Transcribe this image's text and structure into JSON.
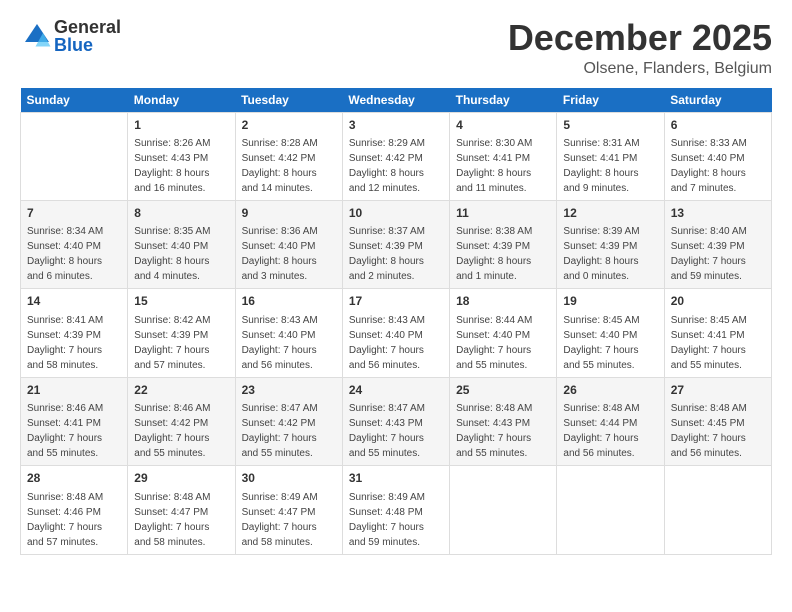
{
  "logo": {
    "general": "General",
    "blue": "Blue"
  },
  "title": "December 2025",
  "subtitle": "Olsene, Flanders, Belgium",
  "days_of_week": [
    "Sunday",
    "Monday",
    "Tuesday",
    "Wednesday",
    "Thursday",
    "Friday",
    "Saturday"
  ],
  "weeks": [
    [
      {
        "day": "",
        "content": ""
      },
      {
        "day": "1",
        "content": "Sunrise: 8:26 AM\nSunset: 4:43 PM\nDaylight: 8 hours\nand 16 minutes."
      },
      {
        "day": "2",
        "content": "Sunrise: 8:28 AM\nSunset: 4:42 PM\nDaylight: 8 hours\nand 14 minutes."
      },
      {
        "day": "3",
        "content": "Sunrise: 8:29 AM\nSunset: 4:42 PM\nDaylight: 8 hours\nand 12 minutes."
      },
      {
        "day": "4",
        "content": "Sunrise: 8:30 AM\nSunset: 4:41 PM\nDaylight: 8 hours\nand 11 minutes."
      },
      {
        "day": "5",
        "content": "Sunrise: 8:31 AM\nSunset: 4:41 PM\nDaylight: 8 hours\nand 9 minutes."
      },
      {
        "day": "6",
        "content": "Sunrise: 8:33 AM\nSunset: 4:40 PM\nDaylight: 8 hours\nand 7 minutes."
      }
    ],
    [
      {
        "day": "7",
        "content": "Sunrise: 8:34 AM\nSunset: 4:40 PM\nDaylight: 8 hours\nand 6 minutes."
      },
      {
        "day": "8",
        "content": "Sunrise: 8:35 AM\nSunset: 4:40 PM\nDaylight: 8 hours\nand 4 minutes."
      },
      {
        "day": "9",
        "content": "Sunrise: 8:36 AM\nSunset: 4:40 PM\nDaylight: 8 hours\nand 3 minutes."
      },
      {
        "day": "10",
        "content": "Sunrise: 8:37 AM\nSunset: 4:39 PM\nDaylight: 8 hours\nand 2 minutes."
      },
      {
        "day": "11",
        "content": "Sunrise: 8:38 AM\nSunset: 4:39 PM\nDaylight: 8 hours\nand 1 minute."
      },
      {
        "day": "12",
        "content": "Sunrise: 8:39 AM\nSunset: 4:39 PM\nDaylight: 8 hours\nand 0 minutes."
      },
      {
        "day": "13",
        "content": "Sunrise: 8:40 AM\nSunset: 4:39 PM\nDaylight: 7 hours\nand 59 minutes."
      }
    ],
    [
      {
        "day": "14",
        "content": "Sunrise: 8:41 AM\nSunset: 4:39 PM\nDaylight: 7 hours\nand 58 minutes."
      },
      {
        "day": "15",
        "content": "Sunrise: 8:42 AM\nSunset: 4:39 PM\nDaylight: 7 hours\nand 57 minutes."
      },
      {
        "day": "16",
        "content": "Sunrise: 8:43 AM\nSunset: 4:40 PM\nDaylight: 7 hours\nand 56 minutes."
      },
      {
        "day": "17",
        "content": "Sunrise: 8:43 AM\nSunset: 4:40 PM\nDaylight: 7 hours\nand 56 minutes."
      },
      {
        "day": "18",
        "content": "Sunrise: 8:44 AM\nSunset: 4:40 PM\nDaylight: 7 hours\nand 55 minutes."
      },
      {
        "day": "19",
        "content": "Sunrise: 8:45 AM\nSunset: 4:40 PM\nDaylight: 7 hours\nand 55 minutes."
      },
      {
        "day": "20",
        "content": "Sunrise: 8:45 AM\nSunset: 4:41 PM\nDaylight: 7 hours\nand 55 minutes."
      }
    ],
    [
      {
        "day": "21",
        "content": "Sunrise: 8:46 AM\nSunset: 4:41 PM\nDaylight: 7 hours\nand 55 minutes."
      },
      {
        "day": "22",
        "content": "Sunrise: 8:46 AM\nSunset: 4:42 PM\nDaylight: 7 hours\nand 55 minutes."
      },
      {
        "day": "23",
        "content": "Sunrise: 8:47 AM\nSunset: 4:42 PM\nDaylight: 7 hours\nand 55 minutes."
      },
      {
        "day": "24",
        "content": "Sunrise: 8:47 AM\nSunset: 4:43 PM\nDaylight: 7 hours\nand 55 minutes."
      },
      {
        "day": "25",
        "content": "Sunrise: 8:48 AM\nSunset: 4:43 PM\nDaylight: 7 hours\nand 55 minutes."
      },
      {
        "day": "26",
        "content": "Sunrise: 8:48 AM\nSunset: 4:44 PM\nDaylight: 7 hours\nand 56 minutes."
      },
      {
        "day": "27",
        "content": "Sunrise: 8:48 AM\nSunset: 4:45 PM\nDaylight: 7 hours\nand 56 minutes."
      }
    ],
    [
      {
        "day": "28",
        "content": "Sunrise: 8:48 AM\nSunset: 4:46 PM\nDaylight: 7 hours\nand 57 minutes."
      },
      {
        "day": "29",
        "content": "Sunrise: 8:48 AM\nSunset: 4:47 PM\nDaylight: 7 hours\nand 58 minutes."
      },
      {
        "day": "30",
        "content": "Sunrise: 8:49 AM\nSunset: 4:47 PM\nDaylight: 7 hours\nand 58 minutes."
      },
      {
        "day": "31",
        "content": "Sunrise: 8:49 AM\nSunset: 4:48 PM\nDaylight: 7 hours\nand 59 minutes."
      },
      {
        "day": "",
        "content": ""
      },
      {
        "day": "",
        "content": ""
      },
      {
        "day": "",
        "content": ""
      }
    ]
  ]
}
